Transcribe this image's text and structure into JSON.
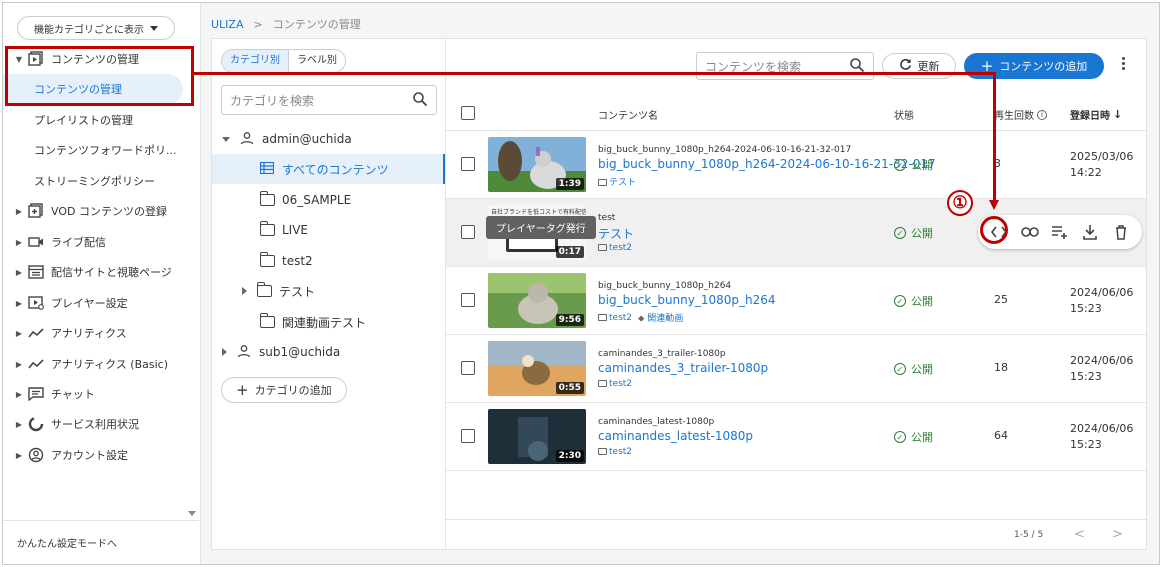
{
  "sidebar": {
    "category_select": "機能カテゴリごとに表示",
    "items": [
      {
        "label": "コンテンツの管理",
        "icon": "content-icon"
      },
      {
        "label": "VOD コンテンツの登録",
        "icon": "vod-add-icon"
      },
      {
        "label": "ライブ配信",
        "icon": "live-icon"
      },
      {
        "label": "配信サイトと視聴ページ",
        "icon": "site-icon"
      },
      {
        "label": "プレイヤー設定",
        "icon": "player-icon"
      },
      {
        "label": "アナリティクス",
        "icon": "analytics-icon"
      },
      {
        "label": "アナリティクス (Basic)",
        "icon": "analytics-basic-icon"
      },
      {
        "label": "チャット",
        "icon": "chat-icon"
      },
      {
        "label": "サービス利用状況",
        "icon": "usage-icon"
      },
      {
        "label": "アカウント設定",
        "icon": "account-icon"
      }
    ],
    "subitems": [
      {
        "label": "コンテンツの管理"
      },
      {
        "label": "プレイリストの管理"
      },
      {
        "label": "コンテンツフォワードポリ..."
      },
      {
        "label": "ストリーミングポリシー"
      }
    ],
    "footer": "かんたん設定モードへ"
  },
  "breadcrumb": {
    "root": "ULIZA",
    "separator": ">",
    "current": "コンテンツの管理"
  },
  "category_panel": {
    "tabs": [
      "カテゴリ別",
      "ラベル別"
    ],
    "search_placeholder": "カテゴリを検索",
    "tree": [
      {
        "label": "admin@uchida"
      },
      {
        "label": "すべてのコンテンツ"
      },
      {
        "label": "06_SAMPLE"
      },
      {
        "label": "LIVE"
      },
      {
        "label": "test2"
      },
      {
        "label": "テスト"
      },
      {
        "label": "関連動画テスト"
      },
      {
        "label": "sub1@uchida"
      }
    ],
    "add_button": "カテゴリの追加"
  },
  "content_panel": {
    "search_placeholder": "コンテンツを検索",
    "refresh_button": "更新",
    "add_button": "コンテンツの追加",
    "columns": {
      "name": "コンテンツ名",
      "status": "状態",
      "plays": "再生回数",
      "date": "登録日時"
    },
    "rows": [
      {
        "small_title": "big_buck_bunny_1080p_h264-2024-06-10-16-21-32-017",
        "title": "big_buck_bunny_1080p_h264-2024-06-10-16-21-32-017",
        "tag1": "テスト",
        "tag2": "",
        "duration": "1:39",
        "status": "公開",
        "plays": "3",
        "date1": "2025/03/06",
        "date2": "14:22"
      },
      {
        "small_title": "test",
        "title": "テスト",
        "tag1": "test2",
        "tag2": "",
        "duration": "0:17",
        "status": "公開",
        "plays": "",
        "date1": "",
        "date2": ""
      },
      {
        "small_title": "big_buck_bunny_1080p_h264",
        "title": "big_buck_bunny_1080p_h264",
        "tag1": "test2",
        "tag2": "関連動画",
        "duration": "9:56",
        "status": "公開",
        "plays": "25",
        "date1": "2024/06/06",
        "date2": "15:23"
      },
      {
        "small_title": "caminandes_3_trailer-1080p",
        "title": "caminandes_3_trailer-1080p",
        "tag1": "test2",
        "tag2": "",
        "duration": "0:55",
        "status": "公開",
        "plays": "18",
        "date1": "2024/06/06",
        "date2": "15:23"
      },
      {
        "small_title": "caminandes_latest-1080p",
        "title": "caminandes_latest-1080p",
        "tag1": "test2",
        "tag2": "",
        "duration": "2:30",
        "status": "公開",
        "plays": "64",
        "date1": "2024/06/06",
        "date2": "15:23"
      }
    ],
    "thumb_text": "自社ブランドを低コストで有料配信サイト",
    "tooltip": "プレイヤータグ発行",
    "pagination": "1-5 / 5",
    "pager_prev": "<",
    "pager_next": ">"
  },
  "annotation": {
    "step": "①",
    "color": "#c00000"
  },
  "colors": {
    "accent": "#1976d2",
    "public": "#2e7d32",
    "annotation": "#c00000"
  }
}
